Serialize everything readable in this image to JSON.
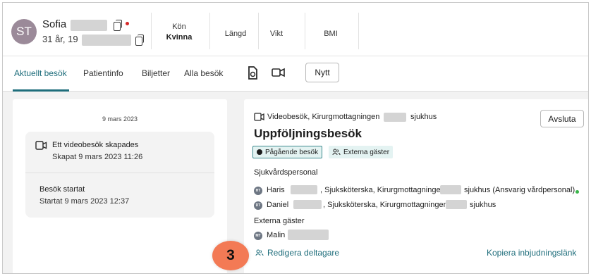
{
  "patient": {
    "initials": "ST",
    "first_name": "Sofia",
    "age": "31 år, 19",
    "fields": [
      {
        "label": "Kön",
        "value": "Kvinna"
      },
      {
        "label": "Längd",
        "value": ""
      },
      {
        "label": "Vikt",
        "value": ""
      },
      {
        "label": "BMI",
        "value": ""
      }
    ]
  },
  "tabs": [
    "Aktuellt besök",
    "Patientinfo",
    "Biljetter",
    "Alla besök"
  ],
  "new_button": "Nytt",
  "timeline": {
    "date": "9 mars 2023",
    "events": [
      {
        "title": "Ett videobesök skapades",
        "sub": "Skapat 9 mars 2023 11:26"
      },
      {
        "title": "Besök startat",
        "sub": "Startat 9 mars 2023 12:37"
      }
    ]
  },
  "visit": {
    "type_prefix": "Videobesök, Kirurgmottagningen",
    "type_suffix": "sjukhus",
    "end_button": "Avsluta",
    "title": "Uppföljningsbesök",
    "badge_ongoing": "Pågående besök",
    "badge_guests": "Externa gäster",
    "staff_heading": "Sjukvårdspersonal",
    "staff": [
      {
        "initials": "HT",
        "name": "Haris",
        "role": ", Sjuksköterska, Kirurgmottagningen",
        "suffix": "sjukhus (Ansvarig vårdpersonal)"
      },
      {
        "initials": "DT",
        "name": "Daniel",
        "role": ", Sjuksköterska, Kirurgmottagningen",
        "suffix": "sjukhus"
      }
    ],
    "guests_heading": "Externa gäster",
    "guests": [
      {
        "initials": "MT",
        "name": "Malin"
      }
    ],
    "edit_link": "Redigera deltagare",
    "copy_link": "Kopiera inbjudningslänk"
  },
  "step_number": "3",
  "colors": {
    "accent": "#1e6d7b",
    "step": "#f37a55",
    "online": "#3ab54a"
  }
}
